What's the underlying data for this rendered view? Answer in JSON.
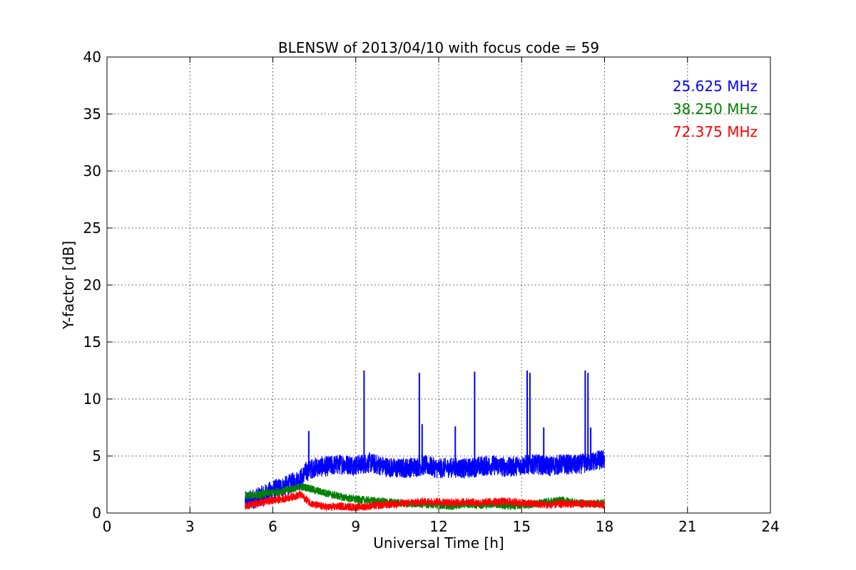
{
  "chart_data": {
    "type": "line",
    "title": "BLENSW of 2013/04/10 with focus code = 59",
    "xlabel": "Universal Time [h]",
    "ylabel": "Y-factor [dB]",
    "xlim": [
      0,
      24
    ],
    "ylim": [
      0,
      40
    ],
    "xticks": [
      0,
      3,
      6,
      9,
      12,
      15,
      18,
      21,
      24
    ],
    "yticks": [
      0,
      5,
      10,
      15,
      20,
      25,
      30,
      35,
      40
    ],
    "grid": true,
    "legend_placement": "top-right",
    "series": [
      {
        "name": "25.625 MHz",
        "color": "#0000ff",
        "x": [
          5.0,
          5.5,
          6.0,
          6.5,
          7.0,
          7.2,
          7.5,
          8.0,
          8.5,
          9.0,
          9.5,
          10.0,
          10.5,
          11.0,
          11.5,
          12.0,
          12.5,
          13.0,
          13.5,
          14.0,
          14.5,
          15.0,
          15.5,
          16.0,
          16.5,
          17.0,
          17.5,
          18.0
        ],
        "values": [
          1.0,
          1.4,
          2.0,
          2.4,
          3.0,
          3.6,
          4.0,
          4.1,
          4.3,
          4.2,
          4.4,
          4.1,
          3.9,
          4.0,
          4.2,
          3.9,
          4.0,
          3.9,
          4.1,
          4.2,
          4.0,
          4.2,
          4.3,
          4.1,
          4.3,
          4.2,
          4.5,
          4.7
        ],
        "spikes": [
          {
            "x": 7.3,
            "y": 7.2
          },
          {
            "x": 9.3,
            "y": 12.5
          },
          {
            "x": 11.3,
            "y": 12.3
          },
          {
            "x": 11.4,
            "y": 7.8
          },
          {
            "x": 12.6,
            "y": 7.6
          },
          {
            "x": 13.3,
            "y": 12.4
          },
          {
            "x": 15.2,
            "y": 12.5
          },
          {
            "x": 15.3,
            "y": 12.3
          },
          {
            "x": 15.8,
            "y": 7.5
          },
          {
            "x": 17.3,
            "y": 12.5
          },
          {
            "x": 17.4,
            "y": 12.3
          },
          {
            "x": 17.5,
            "y": 7.5
          }
        ]
      },
      {
        "name": "38.250 MHz",
        "color": "#008000",
        "x": [
          5.0,
          5.5,
          6.0,
          6.5,
          7.0,
          7.3,
          7.5,
          8.0,
          8.5,
          9.0,
          9.5,
          10.0,
          10.5,
          11.0,
          11.5,
          12.0,
          12.5,
          13.0,
          13.5,
          14.0,
          14.5,
          15.0,
          15.5,
          16.0,
          16.5,
          17.0,
          17.5,
          18.0
        ],
        "values": [
          1.5,
          1.6,
          1.8,
          2.0,
          2.3,
          2.2,
          2.0,
          1.7,
          1.4,
          1.2,
          1.1,
          1.0,
          0.9,
          0.8,
          0.8,
          0.7,
          0.6,
          0.8,
          0.7,
          0.8,
          0.6,
          0.7,
          0.8,
          1.0,
          1.1,
          0.9,
          0.8,
          0.9
        ]
      },
      {
        "name": "72.375 MHz",
        "color": "#ff0000",
        "x": [
          5.0,
          5.5,
          6.0,
          6.5,
          7.0,
          7.3,
          7.5,
          8.0,
          8.5,
          9.0,
          9.5,
          10.0,
          10.5,
          11.0,
          11.5,
          12.0,
          12.5,
          13.0,
          13.5,
          14.0,
          14.5,
          15.0,
          15.5,
          16.0,
          16.5,
          17.0,
          17.5,
          18.0
        ],
        "values": [
          0.6,
          0.9,
          1.1,
          1.3,
          1.6,
          1.0,
          0.7,
          0.5,
          0.6,
          0.5,
          0.6,
          0.7,
          0.8,
          0.9,
          1.0,
          1.0,
          0.9,
          1.0,
          0.9,
          1.0,
          1.0,
          0.9,
          0.8,
          0.7,
          0.8,
          0.8,
          0.8,
          0.7
        ]
      }
    ]
  }
}
